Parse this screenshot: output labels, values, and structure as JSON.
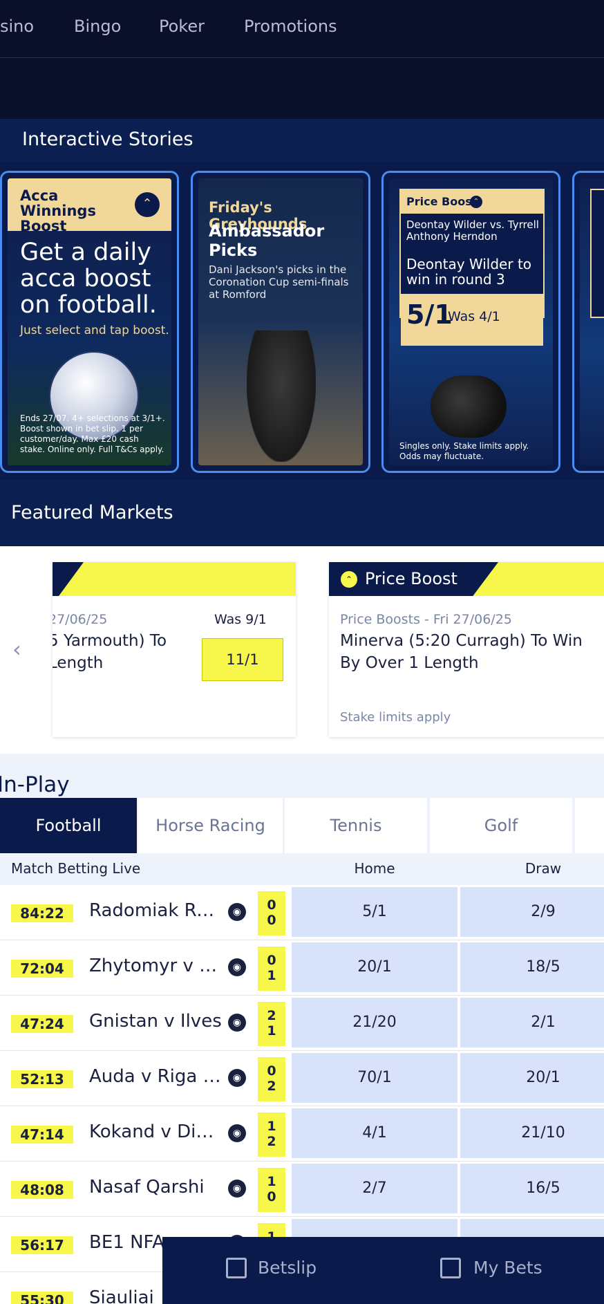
{
  "topnav": {
    "items": [
      "sino",
      "Bingo",
      "Poker",
      "Promotions"
    ]
  },
  "stories": {
    "title": "Interactive Stories",
    "items": [
      {
        "header": "Acca Winnings Boost",
        "headline": "Get a daily acca boost on football.",
        "sub": "Just select and tap boost.",
        "terms": "Ends 27/07. 4+ selections at 3/1+. Boost shown in bet slip. 1 per customer/day. Max £20 cash stake. Online only. Full T&Cs apply."
      },
      {
        "eyebrow": "Friday's Greyhounds",
        "title": "Ambassador Picks",
        "body": "Dani Jackson's picks in the Coronation Cup semi-finals at Romford"
      },
      {
        "tag": "Price Boost",
        "selection": "Deontay Wilder vs. Tyrrell Anthony Herndon",
        "name": "Deontay Wilder to win in round 3",
        "odds": "5/1",
        "was": "Was 4/1",
        "terms": "Singles only. Stake limits apply. Odds may fluctuate."
      }
    ]
  },
  "featured": {
    "title": "Featured Markets",
    "cards": [
      {
        "date": "27/06/25",
        "was": "Was 9/1",
        "selection": "5 Yarmouth) To Length",
        "odds": "11/1"
      },
      {
        "header": "Price Boost",
        "date": "Price Boosts - Fri 27/06/25",
        "selection": "Minerva (5:20 Curragh) To Win By Over 1 Length",
        "note": "Stake limits apply"
      }
    ]
  },
  "inplay": {
    "title": "In-Play",
    "tabs": [
      "Football",
      "Horse Racing",
      "Tennis",
      "Golf"
    ],
    "market_label": "Match Betting Live",
    "columns": [
      "Home",
      "Draw"
    ],
    "rows": [
      {
        "clock": "84:22",
        "team": "Radomiak Radom",
        "score": "0\n0",
        "home": "5/1",
        "draw": "2/9"
      },
      {
        "clock": "72:04",
        "team": "Zhytomyr v Dynamo",
        "score": "0\n1",
        "home": "20/1",
        "draw": "18/5"
      },
      {
        "clock": "47:24",
        "team": "Gnistan v Ilves",
        "score": "2\n1",
        "home": "21/20",
        "draw": "2/1"
      },
      {
        "clock": "52:13",
        "team": "Auda v Riga FC",
        "score": "0\n2",
        "home": "70/1",
        "draw": "20/1"
      },
      {
        "clock": "47:14",
        "team": "Kokand v Dinamo",
        "score": "1\n2",
        "home": "4/1",
        "draw": "21/10"
      },
      {
        "clock": "48:08",
        "team": "Nasaf Qarshi",
        "score": "1\n0",
        "home": "2/7",
        "draw": "16/5"
      },
      {
        "clock": "56:17",
        "team": "BE1 NFA",
        "score": "1\n",
        "home": "",
        "draw": ""
      },
      {
        "clock": "55:30",
        "team": "Siauliai",
        "score": "",
        "home": "",
        "draw": ""
      }
    ]
  },
  "bottom_bar": {
    "betslip": "Betslip",
    "mybets": "My Bets"
  }
}
